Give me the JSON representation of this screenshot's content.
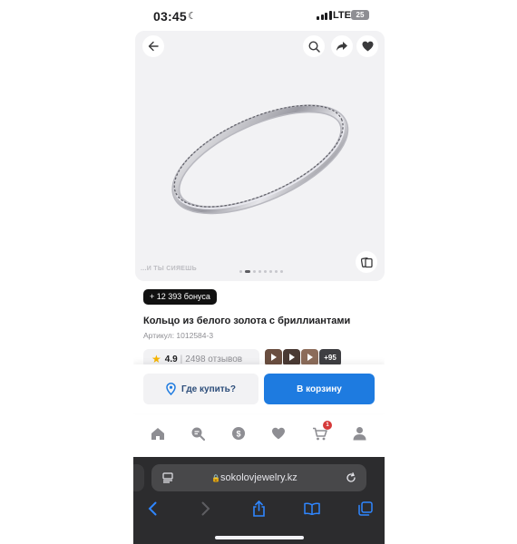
{
  "status_bar": {
    "time": "03:45",
    "network": "LTE",
    "battery": "25"
  },
  "gallery": {
    "watermark": "...И ТЫ СИЯЕШЬ",
    "dots_count": 8,
    "active_dot": 1
  },
  "product": {
    "bonus_badge": "+ 12 393 бонуса",
    "title": "Кольцо из белого золота с бриллиантами",
    "sku": "Артикул: 1012584-3",
    "rating": "4.9",
    "reviews": "2498 отзывов",
    "media_more": "+95"
  },
  "actions": {
    "where_to_buy": "Где купить?",
    "add_to_cart": "В корзину"
  },
  "tabbar": {
    "cart_count": "1"
  },
  "browser": {
    "url": "sokolovjewelry.kz"
  },
  "colors": {
    "primary_button": "#1e7be0",
    "badge_red": "#d63a3a",
    "rating_star": "#f5b400"
  }
}
